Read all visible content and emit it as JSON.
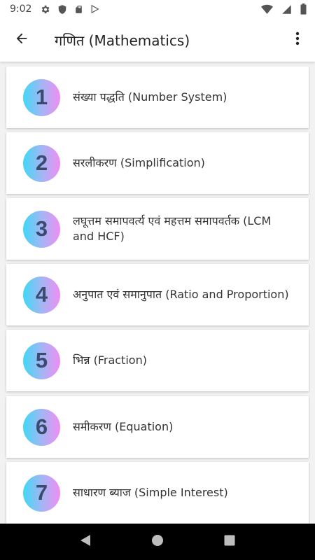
{
  "status_bar": {
    "time": "9:02",
    "left_icons": [
      "gear-icon",
      "shield-icon",
      "sd-card-icon",
      "play-store-icon"
    ],
    "right_icons": [
      "wifi-icon",
      "signal-icon",
      "battery-icon"
    ]
  },
  "app_bar": {
    "title": "गणित (Mathematics)",
    "back_icon": "arrow-back-icon",
    "menu_icon": "more-vert-icon"
  },
  "topics": [
    {
      "number": "1",
      "label": "संख्या पद्धति (Number System)"
    },
    {
      "number": "2",
      "label": "सरलीकरण (Simplification)"
    },
    {
      "number": "3",
      "label": "लघूत्तम समापवर्त्य एवं महत्तम समापवर्तक (LCM and HCF)"
    },
    {
      "number": "4",
      "label": "अनुपात एवं समानुपात (Ratio and Proportion)"
    },
    {
      "number": "5",
      "label": "भिन्न (Fraction)"
    },
    {
      "number": "6",
      "label": "समीकरण (Equation)"
    },
    {
      "number": "7",
      "label": "साधारण ब्याज (Simple Interest)"
    }
  ],
  "nav_bar": {
    "buttons": [
      "back-triangle-icon",
      "home-circle-icon",
      "recents-square-icon"
    ]
  },
  "colors": {
    "badge_gradient_start": "#3fd8f6",
    "badge_gradient_end": "#ef8ef3",
    "badge_number": "#3b4a6e"
  }
}
